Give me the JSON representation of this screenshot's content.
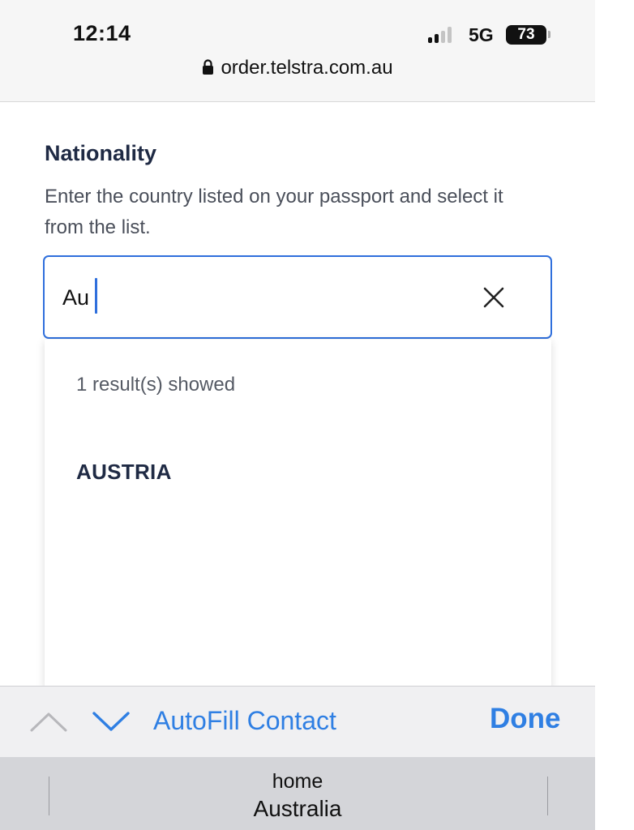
{
  "status_bar": {
    "time": "12:14",
    "network": "5G",
    "battery": "73",
    "signal_bars_active": 2,
    "signal_bars_total": 4
  },
  "browser": {
    "url": "order.telstra.com.au"
  },
  "form": {
    "label": "Nationality",
    "hint": "Enter the country listed on your passport and select it from the list.",
    "input_value": "Au"
  },
  "dropdown": {
    "result_count": "1 result(s) showed",
    "options": [
      "AUSTRIA"
    ]
  },
  "accessory_bar": {
    "autofill_label": "AutoFill Contact",
    "done_label": "Done"
  },
  "keyboard_suggestion": {
    "line1": "home",
    "line2": "Australia"
  },
  "colors": {
    "accent": "#2f6fdc",
    "ios_blue": "#2f7fe3",
    "label_navy": "#1f2a44"
  },
  "icons": {
    "lock": "lock-icon",
    "clear": "close-icon",
    "previous": "chevron-up-icon",
    "next": "chevron-down-icon"
  }
}
